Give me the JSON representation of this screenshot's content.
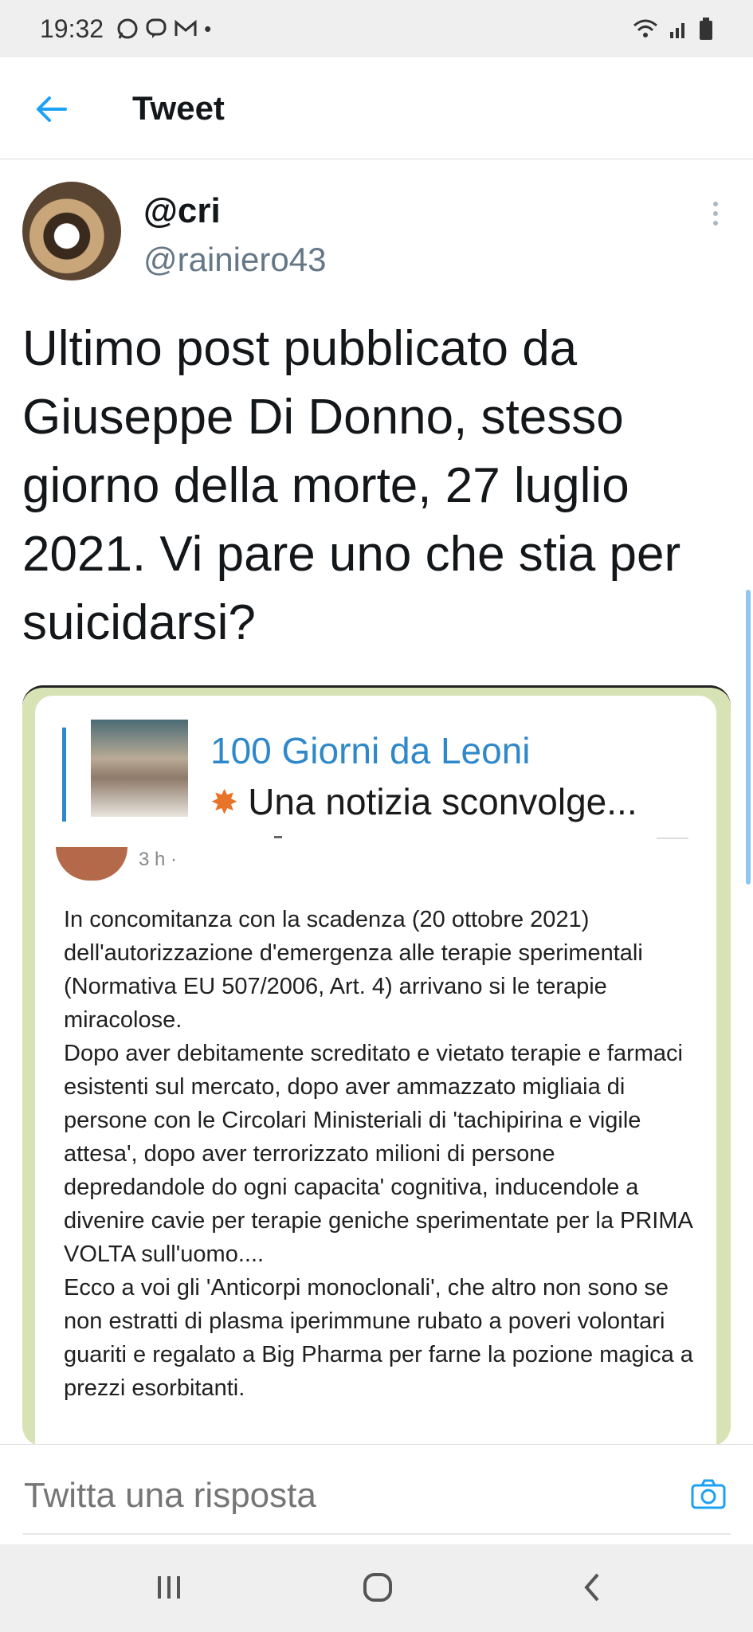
{
  "status_bar": {
    "time": "19:32",
    "left_icons": [
      "whatsapp-icon",
      "viber-icon",
      "gmail-icon",
      "dot-icon"
    ],
    "right_icons": [
      "wifi-icon",
      "signal-icon",
      "battery-icon"
    ]
  },
  "app_bar": {
    "back_icon": "arrow-left-icon",
    "title": "Tweet",
    "accent_color": "#1da1f2"
  },
  "tweet": {
    "display_name": "@cri",
    "handle": "@rainiero43",
    "text": "Ultimo post pubblicato da Giuseppe Di Donno, stesso giorno della morte, 27 luglio 2021. Vi pare uno che stia per suicidarsi?",
    "more_icon": "vertical-dots-icon"
  },
  "media": {
    "quote_title": "100 Giorni da Leoni",
    "quote_subtitle": "Una notizia sconvolge...",
    "quote_icon": "burst-icon",
    "post_meta": "3 h ·",
    "post_paragraphs": [
      "In concomitanza con la scadenza (20 ottobre 2021) dell'autorizzazione d'emergenza alle terapie sperimentali (Normativa EU 507/2006, Art. 4) arrivano si le terapie miracolose.",
      "Dopo aver debitamente screditato e vietato terapie e farmaci esistenti sul mercato, dopo aver ammazzato migliaia di persone con le Circolari Ministeriali di 'tachipirina e vigile attesa', dopo aver terrorizzato milioni di persone depredandole do ogni capacita' cognitiva, inducendole a divenire cavie per terapie geniche sperimentate per la PRIMA VOLTA sull'uomo....",
      "Ecco a voi gli 'Anticorpi monoclonali', che altro non sono se non estratti di plasma iperimmune rubato a poveri volontari guariti e regalato a Big Pharma per farne la pozione magica a prezzi esorbitanti."
    ]
  },
  "reply": {
    "placeholder": "Twitta una risposta",
    "camera_icon": "camera-icon"
  },
  "nav_bar": {
    "icons": [
      "recent-apps-icon",
      "home-icon",
      "back-icon"
    ]
  }
}
